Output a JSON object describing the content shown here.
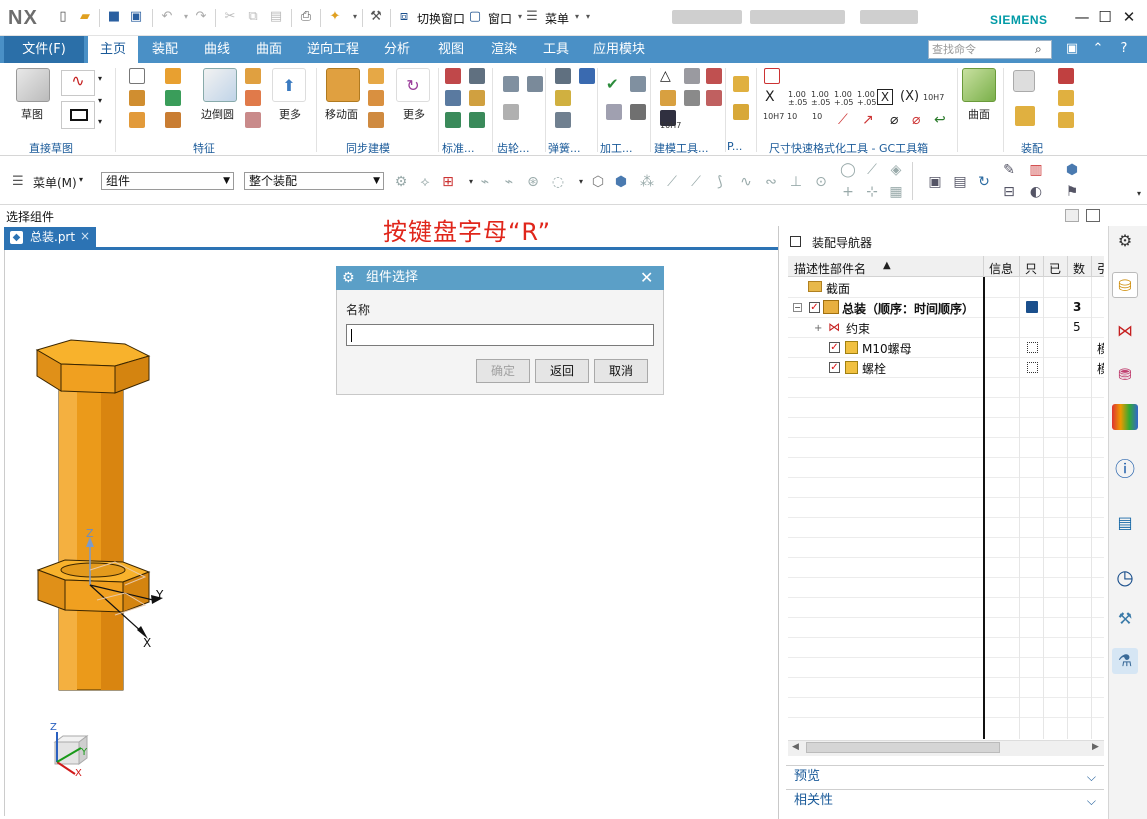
{
  "titlebar": {
    "logo": "NX",
    "switch_window": "切换窗口",
    "window_menu": "窗口",
    "menu": "菜单",
    "brand": "SIEMENS",
    "minimize": "—",
    "maximize": "☐",
    "close": "✕"
  },
  "tabs": {
    "file": "文件(F)",
    "items": [
      "主页",
      "装配",
      "曲线",
      "曲面",
      "逆向工程",
      "分析",
      "视图",
      "渲染",
      "工具",
      "应用模块"
    ],
    "search_placeholder": "查找命令"
  },
  "ribbon": {
    "sketch": "草图",
    "edge_blend": "边倒圆",
    "more": "更多",
    "move_face": "移动面",
    "surface": "曲面",
    "groups": {
      "direct_sketch": "直接草图",
      "feature": "特征",
      "sync_modeling": "同步建模",
      "standard": "标准...",
      "gear": "齿轮...",
      "spring": "弹簧...",
      "machining": "加工...",
      "modeling_tools": "建模工具...",
      "p": "P...",
      "dimension_tools": "尺寸快速格式化工具 - GC工具箱",
      "assembly": "装配"
    },
    "gc_texts": [
      "1.00",
      "±.05",
      "1.00",
      "±.05",
      "1.00",
      "+.05",
      "1.00",
      "+.05",
      "10H7",
      "10H7",
      "10",
      "10H7"
    ]
  },
  "toolbar2": {
    "menu": "菜单(M)",
    "filter": "组件",
    "scope": "整个装配"
  },
  "selection_bar": {
    "label": "选择组件",
    "hint": "按键盘字母“R”"
  },
  "file_tab": {
    "name": "总装.prt",
    "close": "×"
  },
  "viewport": {
    "axis_z": "Z",
    "axis_y": "Y",
    "axis_x": "X",
    "triad_z": "Z",
    "triad_y": "Y",
    "triad_x": "X"
  },
  "dialog": {
    "title": "组件选择",
    "name_label": "名称",
    "name_value": "",
    "ok": "确定",
    "back": "返回",
    "cancel": "取消"
  },
  "navigator": {
    "title": "装配导航器",
    "columns": [
      "描述性部件名",
      "信息",
      "只",
      "已",
      "数",
      "引"
    ],
    "rows": [
      {
        "name": "截面",
        "count": ""
      },
      {
        "name": "总装（顺序：时间顺序）",
        "count": "3"
      },
      {
        "name": "约束",
        "count": "5"
      },
      {
        "name": "M10螺母",
        "count": "",
        "ref": "模"
      },
      {
        "name": "螺栓",
        "count": "",
        "ref": "模"
      }
    ],
    "preview": "预览",
    "relations": "相关性"
  },
  "colors": {
    "ribbon_blue": "#4a90c6",
    "dialog_title": "#5b9fc7",
    "part_orange": "#f0a020",
    "hint_red": "#e0261b"
  }
}
